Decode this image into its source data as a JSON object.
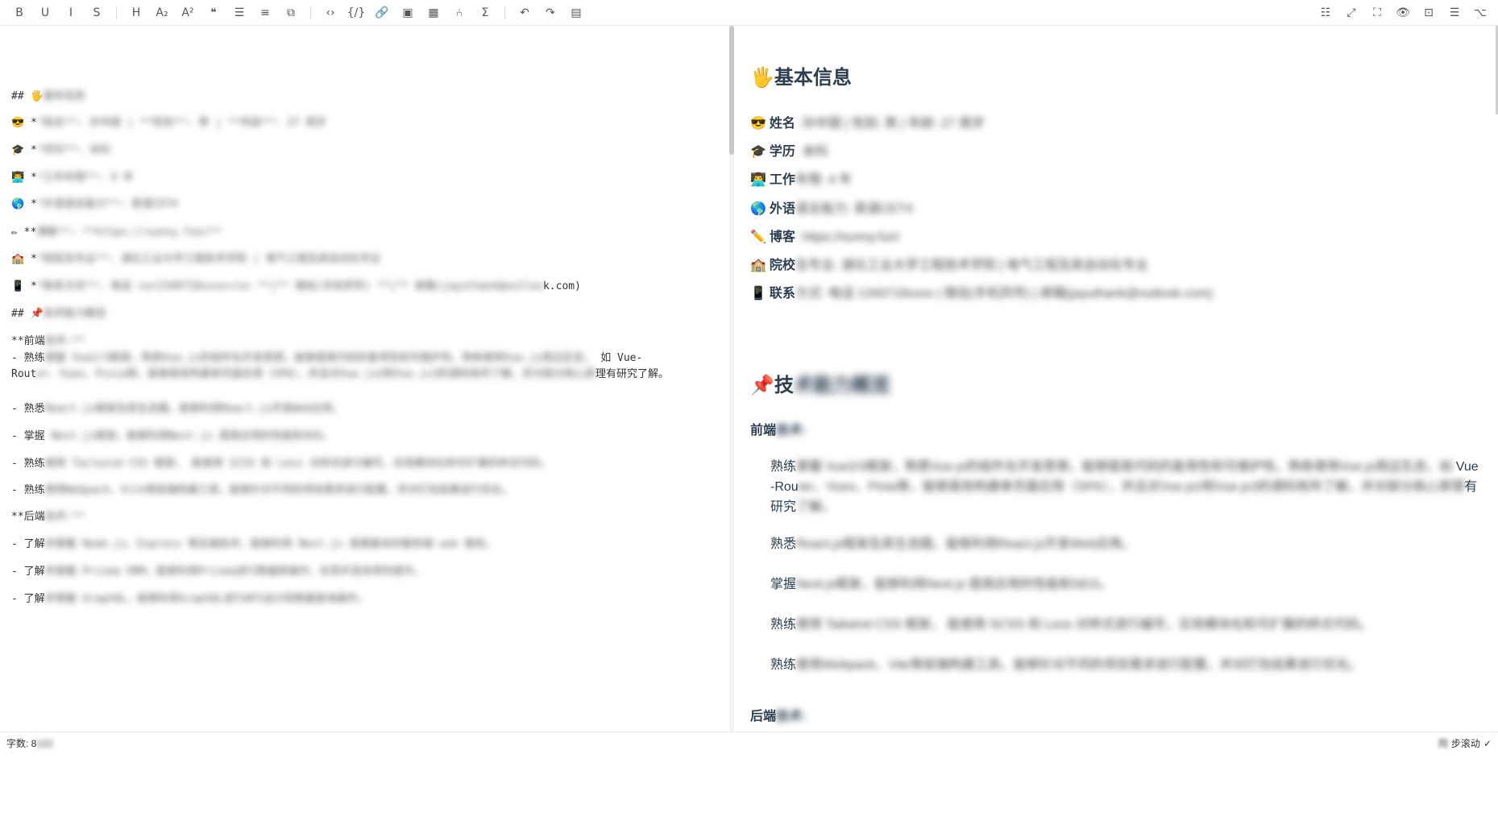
{
  "toolbar": {
    "left_groups": [
      [
        {
          "name": "bold-button",
          "glyph": "B"
        },
        {
          "name": "underline-button",
          "glyph": "U"
        },
        {
          "name": "italic-button",
          "glyph": "I"
        },
        {
          "name": "strikethrough-button",
          "glyph": "S"
        }
      ],
      [
        {
          "name": "heading-button",
          "glyph": "H"
        },
        {
          "name": "subscript-button",
          "glyph": "A₂"
        },
        {
          "name": "superscript-button",
          "glyph": "A²"
        },
        {
          "name": "quote-button",
          "glyph": "❝"
        },
        {
          "name": "unordered-list-button",
          "glyph": "☰"
        },
        {
          "name": "ordered-list-button",
          "glyph": "≡"
        },
        {
          "name": "task-list-button",
          "glyph": "⧉"
        }
      ],
      [
        {
          "name": "code-row-button",
          "glyph": "‹›"
        },
        {
          "name": "code-block-button",
          "glyph": "{/}"
        },
        {
          "name": "link-button",
          "glyph": "🔗"
        },
        {
          "name": "image-button",
          "glyph": "▣"
        },
        {
          "name": "table-button",
          "glyph": "▦"
        },
        {
          "name": "mermaid-button",
          "glyph": "⑃"
        },
        {
          "name": "katex-button",
          "glyph": "Σ"
        }
      ],
      [
        {
          "name": "undo-button",
          "glyph": "↶"
        },
        {
          "name": "redo-button",
          "glyph": "↷"
        },
        {
          "name": "save-button",
          "glyph": "▤"
        }
      ]
    ],
    "right_buttons": [
      {
        "name": "prettier-button",
        "glyph": "☷"
      },
      {
        "name": "page-fullscreen-button",
        "glyph": "⤢"
      },
      {
        "name": "fullscreen-button",
        "glyph": "⛶"
      },
      {
        "name": "preview-button",
        "glyph": "👁"
      },
      {
        "name": "html-preview-button",
        "glyph": "⊡"
      },
      {
        "name": "catalog-button",
        "glyph": "☰"
      },
      {
        "name": "github-button",
        "glyph": "⌥"
      }
    ]
  },
  "editor": {
    "lines": [
      {
        "prefix": "## 🖐",
        "blur": "基本信息"
      },
      {
        "prefix": "😎 *",
        "blur": "*姓名**: 孙中国 | **性别**: 男 | **年龄**: 27 周岁"
      },
      {
        "prefix": "🎓 *",
        "blur": "*学历**: 本科"
      },
      {
        "prefix": "👨‍💻 *",
        "blur": "*工作年限**: 4 年"
      },
      {
        "prefix": "🌎 *",
        "blur": "*外语语言能力**: 英语CET4"
      },
      {
        "prefix": "✏ **",
        "blur": "博客**: **https://sunny.fun/**"
      },
      {
        "prefix": "🏫 *",
        "blur": "*院校及专业**: 湖北工业大学工程技术学院 | 电气工程及其自动化专业"
      },
      {
        "prefix": "📱 *",
        "blur": "*联系方式**: 电话 <u>1340718xxxx</u> **|** 微信(手机同号) **|** 邮箱(jayuthank@outloo",
        "suffix": "k.com)"
      },
      {
        "prefix": "## 📌",
        "blur": "技术能力概览"
      },
      {
        "prefix": "**前端",
        "blur": "技术:**"
      },
      {
        "prefix": "- 熟练",
        "blur": "掌握 Vue2/3框架，熟悉Vue.js的组件化开发思想，能够提高代码的复用性和可维护性。熟练使用Vue.js周边生态，",
        "suffix": " 如 Vue-",
        "wrap2_prefix": "Rout",
        "wrap2_blur": "er、Vuex、Pinia等，能够高效构建单页面应用（SPA），并且对Vue.js2和Vue.js3的源码有所了解，并对部分核心原",
        "wrap2_suffix": "理有研究了解。"
      },
      {
        "prefix": "- 熟悉",
        "blur": "React.js框架及其生态圈，能够利用React.js开发Web应用。"
      },
      {
        "prefix": "- 掌握",
        "blur": " Next.js框架，能够利用Next.js 提高应用的性能和SEO。"
      },
      {
        "prefix": "- 熟练",
        "blur": "使用 Tailwind CSS 框架， 能使用 SCSS 和 Less 对样式进行编写，实现模块化和可扩展的样式代码。"
      },
      {
        "prefix": "- 熟练",
        "blur": "使用Webpack、Vite等前端构建工具，能够针对不同的项目需求进行配置，并对打包结果进行优化。"
      },
      {
        "prefix": "**后端",
        "blur": "技术:**"
      },
      {
        "prefix": "- 了解",
        "blur": "并掌握 Node.js、Express 等后端技术，能够利用 Nest.js 搭建基本的服务端 web 服务。"
      },
      {
        "prefix": "- 了解",
        "blur": "并掌握 Prisma ORM，能够利用Prisma进行数据库操作，实现开发效率的提升。"
      },
      {
        "prefix": "- 了解",
        "blur": "并掌握 GraphQL，能够利用GraphQL进行API设计和数据查询操作。"
      }
    ]
  },
  "preview": {
    "h2_1": {
      "emoji": "🖐",
      "text": "基本信息"
    },
    "rows": [
      {
        "emoji": "😎",
        "label": "姓名",
        "blur": ": 孙中国 | 性别: 男 | 年龄: 27 周岁"
      },
      {
        "emoji": "🎓",
        "label": "学历",
        "blur": ": 本科"
      },
      {
        "emoji": "👨‍💻",
        "label": "工作",
        "blur": "年限: 4 年"
      },
      {
        "emoji": "🌎",
        "label": "外语",
        "blur": "语言能力: 英语CET4"
      },
      {
        "emoji": "✏️",
        "label": "博客",
        "blur": ": https://sunny.fun/"
      },
      {
        "emoji": "🏫",
        "label": "院校",
        "blur": "及专业: 湖北工业大学工程技术学院 | 电气工程及其自动化专业"
      },
      {
        "emoji": "📱",
        "label": "联系",
        "blur": "方式: 电话 1340718xxxx | 微信(手机同号) | 邮箱(jayuthank@outlook.com)"
      }
    ],
    "h2_2": {
      "emoji": "📌",
      "text": "技",
      "blur": "术能力概览"
    },
    "sub_1": {
      "text": "前端",
      "blur": "技术:"
    },
    "items": [
      {
        "prefix": "熟练",
        "blur": "掌握 Vue2/3框架，熟悉Vue.js的组件化开发思想，能够提高代码的复用性和可维护性。熟练使用Vue.js周边生态，如",
        "suffix": " Vue",
        "line2_prefix": "-Rou",
        "line2_blur": "ter、Vuex、Pinia等，能够高效构建单页面应用（SPA），并且对Vue.js2和Vue.js3的源码有所了解，并对部分核心原理",
        "line2_suffix": "有",
        "line3_prefix": "研究",
        "line3_blur": "了解。"
      },
      {
        "prefix": "熟悉",
        "blur": "React.js框架及其生态圈，能够利用React.js开发Web应用。"
      },
      {
        "prefix": "掌握",
        "blur": "Next.js框架，能够利用Next.js 提高应用的性能和SEO。"
      },
      {
        "prefix": "熟练",
        "blur": "使用 Tailwind CSS 框架， 能使用 SCSS 和 Less 对样式进行编写，实现模块化和可扩展的样式代码。"
      },
      {
        "prefix": "熟练",
        "blur": "使用Webpack、Vite等前端构建工具，能够针对不同的项目需求进行配置，并对打包结果进行优化。"
      }
    ],
    "sub_2": {
      "text": "后端",
      "blur": "技术:"
    }
  },
  "status": {
    "wordcount_label": "字数: 8",
    "wordcount_blur": "122",
    "sync_blur": "同",
    "sync_label": "步滚动",
    "sync_check": "✓"
  }
}
